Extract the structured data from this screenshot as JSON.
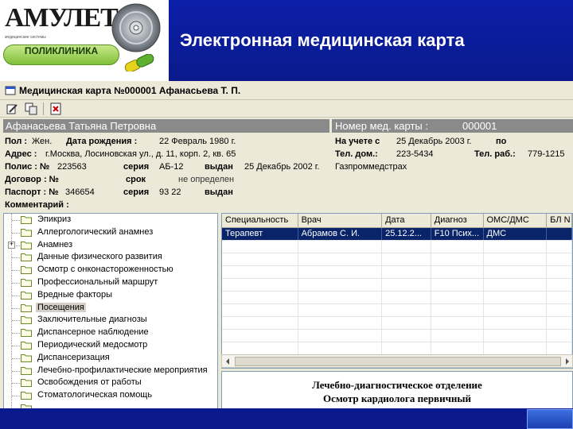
{
  "slide": {
    "title": "Электронная медицинская карта",
    "logo": {
      "brand": "АМУЛЕТ",
      "tagline": "медицинские системы",
      "product": "ПОЛИКЛИНИКА"
    }
  },
  "window": {
    "title": "Медицинская карта №000001 Афанасьева Т. П."
  },
  "patient": {
    "full_name": "Афанасьева Татьяна Петровна",
    "card_label": "Номер мед. карты :",
    "card_number": "000001",
    "sex_label": "Пол :",
    "sex_value": "Жен.",
    "dob_label": "Дата рождения :",
    "dob_value": "22 Февраль 1980 г.",
    "registered_label": "На учете с",
    "registered_value": "25 Декабрь 2003 г.",
    "registered_by": "по",
    "address_label": "Адрес :",
    "address_value": "г.Москва, Лосиновская ул., д. 11, корп. 2, кв. 65",
    "home_phone_label": "Тел. дом.:",
    "home_phone_value": "223-5434",
    "work_phone_label": "Тел. раб.:",
    "work_phone_value": "779-1215",
    "policy_label": "Полис : №",
    "policy_number": "223563",
    "policy_series_label": "серия",
    "policy_series_value": "АБ-12",
    "policy_issued_label": "выдан",
    "policy_issued_value": "25 Декабрь 2002 г.",
    "insurer": "Газпроммедстрах",
    "contract_label": "Договор : №",
    "contract_term_label": "срок",
    "contract_term_value": "не определен",
    "passport_label": "Паспорт : №",
    "passport_number": "346654",
    "passport_series_label": "серия",
    "passport_series_value": "93 22",
    "passport_issued_label": "выдан",
    "comment_label": "Комментарий :"
  },
  "tree": {
    "items": [
      {
        "label": "Эпикриз"
      },
      {
        "label": "Аллергологический анамнез"
      },
      {
        "label": "Анамнез",
        "expander": "+"
      },
      {
        "label": "Данные физического развития"
      },
      {
        "label": "Осмотр с онконастороженностью"
      },
      {
        "label": "Профессиональный маршрут"
      },
      {
        "label": "Вредные факторы"
      },
      {
        "label": "Посещения",
        "selected": true
      },
      {
        "label": "Заключительные диагнозы"
      },
      {
        "label": "Диспансерное наблюдение"
      },
      {
        "label": "Периодический медосмотр"
      },
      {
        "label": "Диспансеризация"
      },
      {
        "label": "Лечебно-профилактические мероприятия"
      },
      {
        "label": "Освобождения от работы"
      },
      {
        "label": "Стоматологическая помощь"
      },
      {
        "label": ""
      }
    ]
  },
  "grid": {
    "columns": [
      "Специальность",
      "Врач",
      "Дата",
      "Диагноз",
      "ОМС/ДМС",
      "БЛ N"
    ],
    "rows": [
      [
        "Терапевт",
        "Абрамов С. И.",
        "25.12.2...",
        "F10 Псих...",
        "ДМС",
        ""
      ]
    ]
  },
  "document": {
    "line1": "Лечебно-диагностическое отделение",
    "line2": "Осмотр кардиолога первичный"
  },
  "colors": {
    "slide_bg": "#0a1a8c",
    "selection": "#0a246a",
    "window_bg": "#ece9d8"
  },
  "icons": [
    "disc-icon",
    "capsule-icon",
    "window-icon",
    "edit-icon",
    "copy-icon",
    "delete-icon",
    "folder-icon"
  ]
}
